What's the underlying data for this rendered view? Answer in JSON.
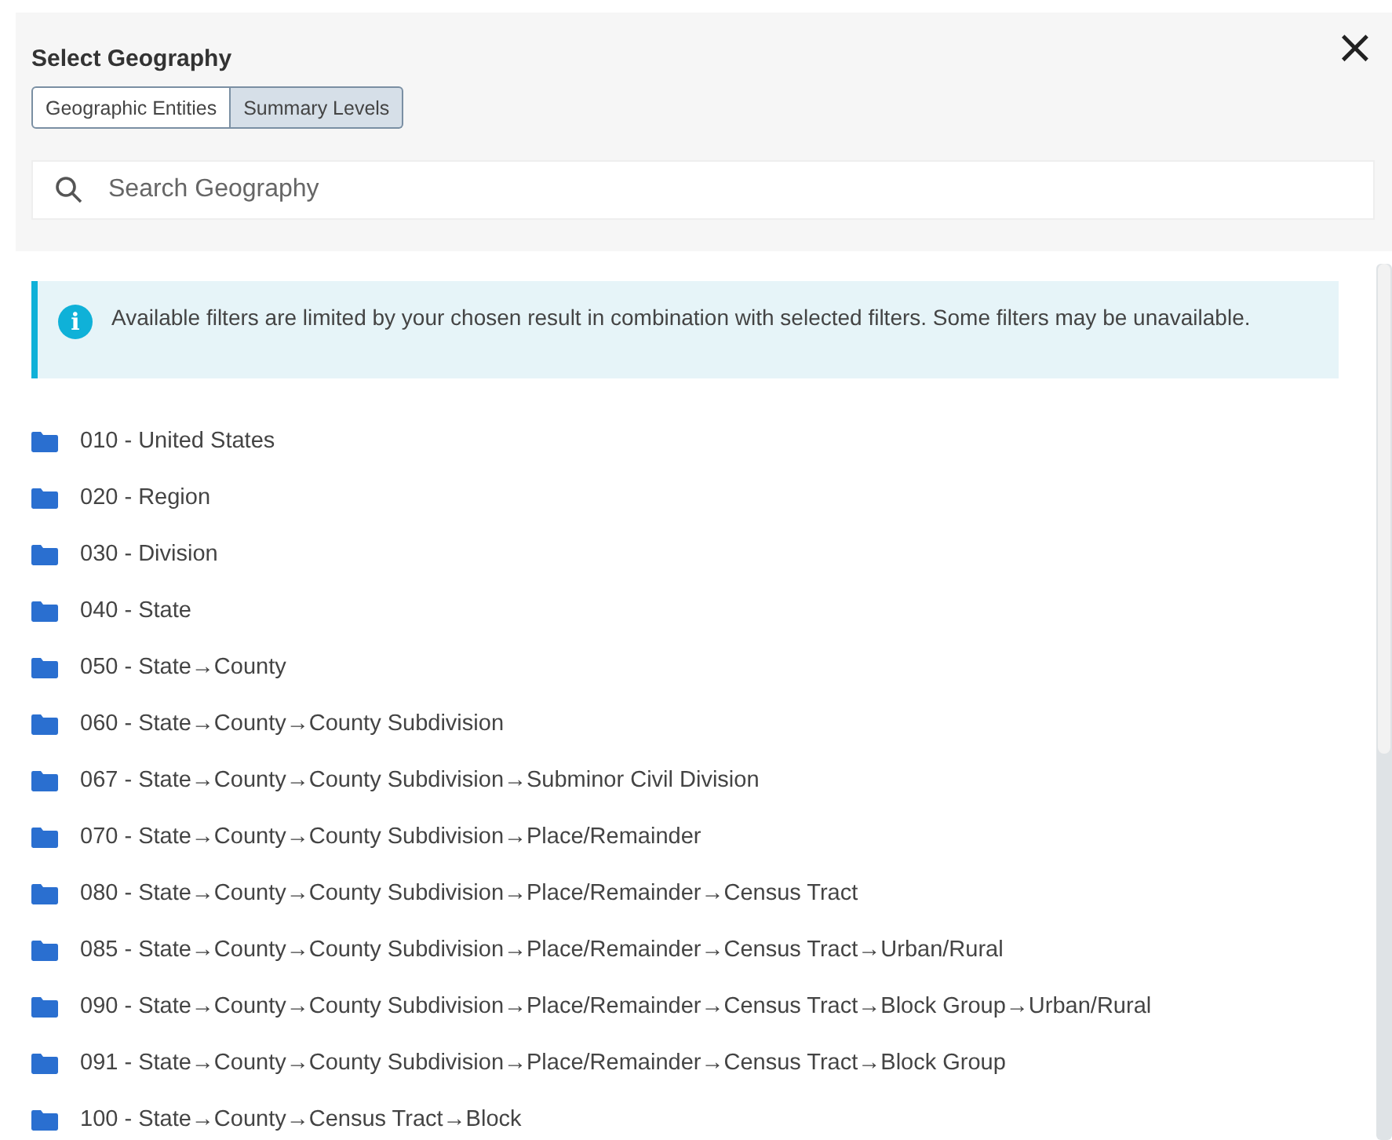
{
  "dialog": {
    "title": "Select Geography",
    "close": "×"
  },
  "tabs": [
    {
      "label": "Geographic Entities",
      "selected": false
    },
    {
      "label": "Summary Levels",
      "selected": true
    }
  ],
  "search": {
    "placeholder": "Search Geography"
  },
  "notice": {
    "icon": "i",
    "text": "Available filters are limited by your chosen result in combination with selected filters. Some filters may be unavailable."
  },
  "summary_levels": [
    {
      "label": "010 - United States"
    },
    {
      "label": "020 - Region"
    },
    {
      "label": "030 - Division"
    },
    {
      "label": "040 - State"
    },
    {
      "label": "050 - State→County"
    },
    {
      "label": "060 - State→County→County Subdivision"
    },
    {
      "label": "067 - State→County→County Subdivision→Subminor Civil Division"
    },
    {
      "label": "070 - State→County→County Subdivision→Place/Remainder"
    },
    {
      "label": "080 - State→County→County Subdivision→Place/Remainder→Census Tract"
    },
    {
      "label": "085 - State→County→County Subdivision→Place/Remainder→Census Tract→Urban/Rural"
    },
    {
      "label": "090 - State→County→County Subdivision→Place/Remainder→Census Tract→Block Group→Urban/Rural"
    },
    {
      "label": "091 - State→County→County Subdivision→Place/Remainder→Census Tract→Block Group"
    },
    {
      "label": "100 - State→County→Census Tract→Block"
    }
  ]
}
